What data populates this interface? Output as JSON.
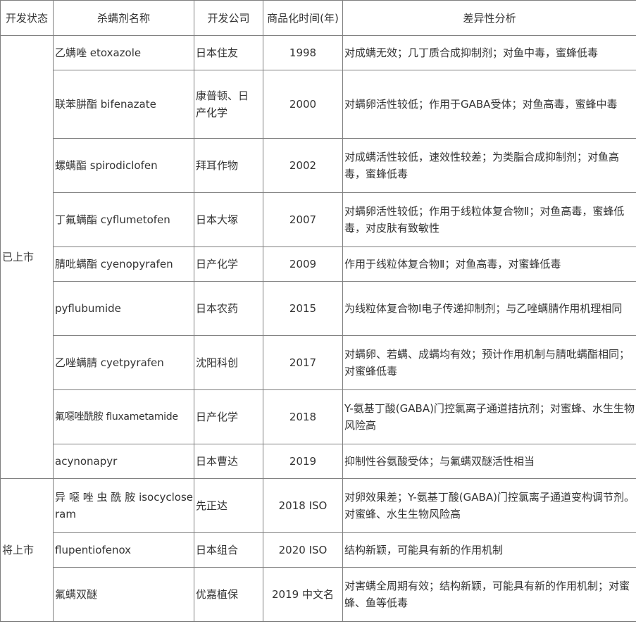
{
  "headers": {
    "status": "开发状态",
    "name": "杀螨剂名称",
    "company": "开发公司",
    "year": "商品化时间(年)",
    "diff": "差异性分析"
  },
  "groups": [
    {
      "status": "已上市",
      "rows": [
        {
          "name": "乙螨唑 etoxazole",
          "company": "日本住友",
          "year": "1998",
          "diff": "对成螨无效；几丁质合成抑制剂；对鱼中毒，蜜蜂低毒"
        },
        {
          "name": "联苯肼酯 bifenazate",
          "company": "康普顿、日产化学",
          "year": "2000",
          "diff": "对螨卵活性较低；作用于GABA受体；对鱼高毒，蜜蜂中毒"
        },
        {
          "name": "螺螨酯 spirodiclofen",
          "company": "拜耳作物",
          "year": "2002",
          "diff": "对成螨活性较低，速效性较差；为类脂合成抑制剂；对鱼高毒，蜜蜂低毒"
        },
        {
          "name": "丁氟螨酯 cyflumetofen",
          "company": "日本大塚",
          "year": "2007",
          "diff": "对螨卵活性较低；作用于线粒体复合物Ⅱ；对鱼高毒，蜜蜂低毒，对皮肤有致敏性"
        },
        {
          "name": "腈吡螨酯 cyenopyrafen",
          "company": "日产化学",
          "year": "2009",
          "diff": "作用于线粒体复合物Ⅱ；对鱼高毒，对蜜蜂低毒"
        },
        {
          "name": "pyflubumide",
          "company": "日本农药",
          "year": "2015",
          "diff": "为线粒体复合物Ⅰ电子传递抑制剂；与乙唑螨腈作用机理相同"
        },
        {
          "name": "乙唑螨腈 cyetpyrafen",
          "company": "沈阳科创",
          "year": "2017",
          "diff": "对螨卵、若螨、成螨均有效；预计作用机制与腈吡螨酯相同；对蜜蜂低毒"
        },
        {
          "name": "氟噁唑酰胺 fluxametamide",
          "company": "日产化学",
          "year": "2018",
          "diff": "Y-氨基丁酸(GABA)门控氯离子通道拮抗剂；对蜜蜂、水生生物风险高"
        },
        {
          "name": "acynonapyr",
          "company": "日本曹达",
          "year": "2019",
          "diff": "抑制性谷氨酸受体；与氟螨双醚活性相当"
        }
      ]
    },
    {
      "status": "将上市",
      "rows": [
        {
          "name": "异 噁 唑 虫 酰 胺 isocycloseram",
          "company": "先正达",
          "year": "2018 ISO",
          "diff": "对卵效果差；Y-氨基丁酸(GABA)门控氯离子通道变构调节剂。对蜜蜂、水生生物风险高"
        },
        {
          "name": "flupentiofenox",
          "company": "日本组合",
          "year": "2020 ISO",
          "diff": "结构新颖，可能具有新的作用机制"
        },
        {
          "name": "氟螨双醚",
          "company": "优嘉植保",
          "year": "2019 中文名",
          "diff": "对害螨全周期有效；结构新颖，可能具有新的作用机制；对蜜蜂、鱼等低毒"
        }
      ]
    }
  ]
}
